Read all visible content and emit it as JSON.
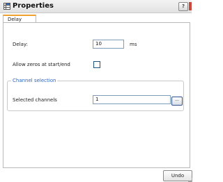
{
  "window": {
    "title": "Properties",
    "help_label": "?"
  },
  "tabs": [
    {
      "label": "Delay",
      "active": true
    }
  ],
  "form": {
    "delay_label": "Delay:",
    "delay_value": "10",
    "delay_unit": "ms",
    "allow_zeros_label": "Allow zeros at start/end",
    "allow_zeros_checked": false,
    "channel_group_title": "Channel selection",
    "selected_channels_label": "Selected channels",
    "selected_channels_value": "1",
    "browse_label": "..."
  },
  "footer": {
    "undo_label": "Undo"
  },
  "icons": {
    "title": "properties-grid-icon"
  }
}
